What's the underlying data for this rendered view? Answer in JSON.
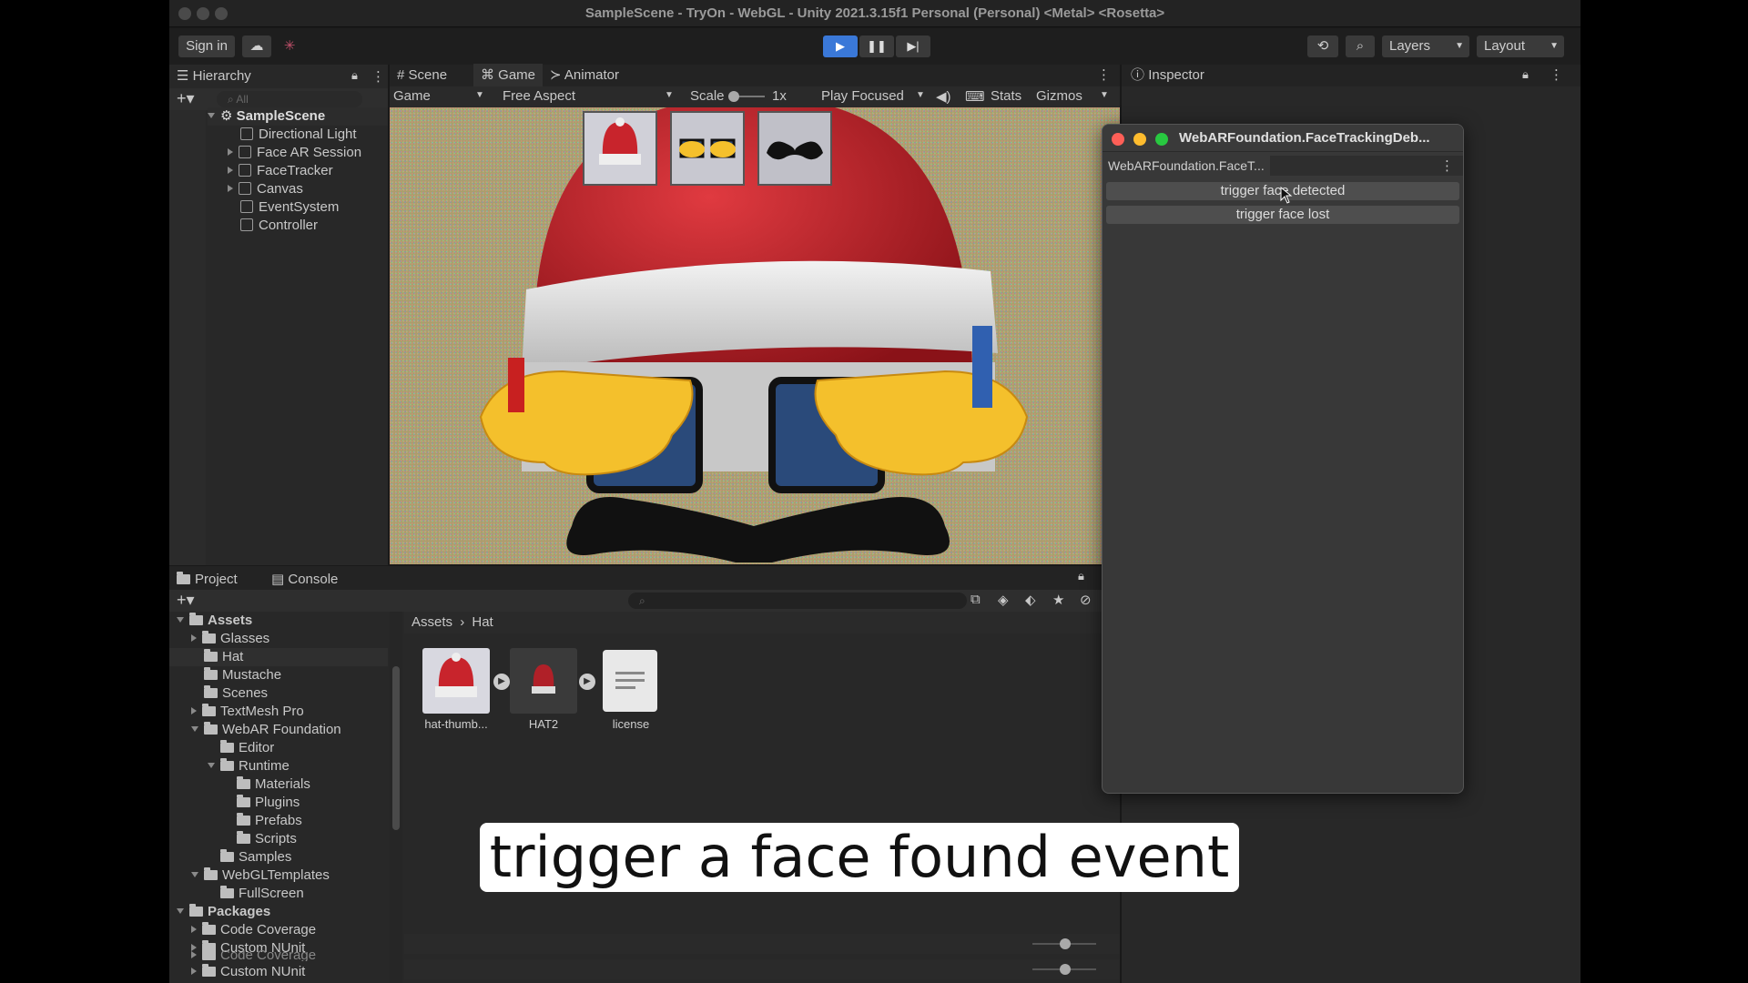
{
  "window_title": "SampleScene - TryOn - WebGL - Unity 2021.3.15f1 Personal (Personal) <Metal> <Rosetta>",
  "toolbar": {
    "sign_in": "Sign in",
    "layers": "Layers",
    "layout": "Layout"
  },
  "hierarchy": {
    "tab": "Hierarchy",
    "search_placeholder": "All",
    "scene": "SampleScene",
    "items": [
      "Directional Light",
      "Face AR Session",
      "FaceTracker",
      "Canvas",
      "EventSystem",
      "Controller"
    ]
  },
  "view_tabs": {
    "scene": "Scene",
    "game": "Game",
    "animator": "Animator"
  },
  "game_bar": {
    "display": "Game",
    "aspect": "Free Aspect",
    "scale_label": "Scale",
    "scale_value": "1x",
    "play_mode": "Play Focused",
    "stats": "Stats",
    "gizmos": "Gizmos"
  },
  "inspector": {
    "tab": "Inspector"
  },
  "dialog": {
    "title": "WebARFoundation.FaceTrackingDeb...",
    "tab": "WebARFoundation.FaceT...",
    "btn_detected": "trigger face detected",
    "btn_lost": "trigger face lost"
  },
  "bottom_tabs": {
    "project": "Project",
    "console": "Console"
  },
  "project_tree": {
    "assets": "Assets",
    "glasses": "Glasses",
    "hat": "Hat",
    "mustache": "Mustache",
    "scenes": "Scenes",
    "textmesh": "TextMesh Pro",
    "webar": "WebAR Foundation",
    "editor": "Editor",
    "runtime": "Runtime",
    "materials": "Materials",
    "plugins": "Plugins",
    "prefabs": "Prefabs",
    "scripts": "Scripts",
    "samples": "Samples",
    "webgltemplates": "WebGLTemplates",
    "fullscreen": "FullScreen",
    "packages": "Packages",
    "codecoverage": "Code Coverage",
    "customnunit": "Custom NUnit",
    "codecoverage2": "Code Coverage",
    "customnunit2": "Custom NUnit"
  },
  "breadcrumb": {
    "root": "Assets",
    "current": "Hat"
  },
  "assets_grid": [
    {
      "label": "hat-thumb..."
    },
    {
      "label": "HAT2"
    },
    {
      "label": "license"
    }
  ],
  "caption": "trigger a face found event",
  "colors": {
    "play_active": "#3a78d8",
    "hat_red": "#c8242c",
    "panel": "#282828"
  }
}
